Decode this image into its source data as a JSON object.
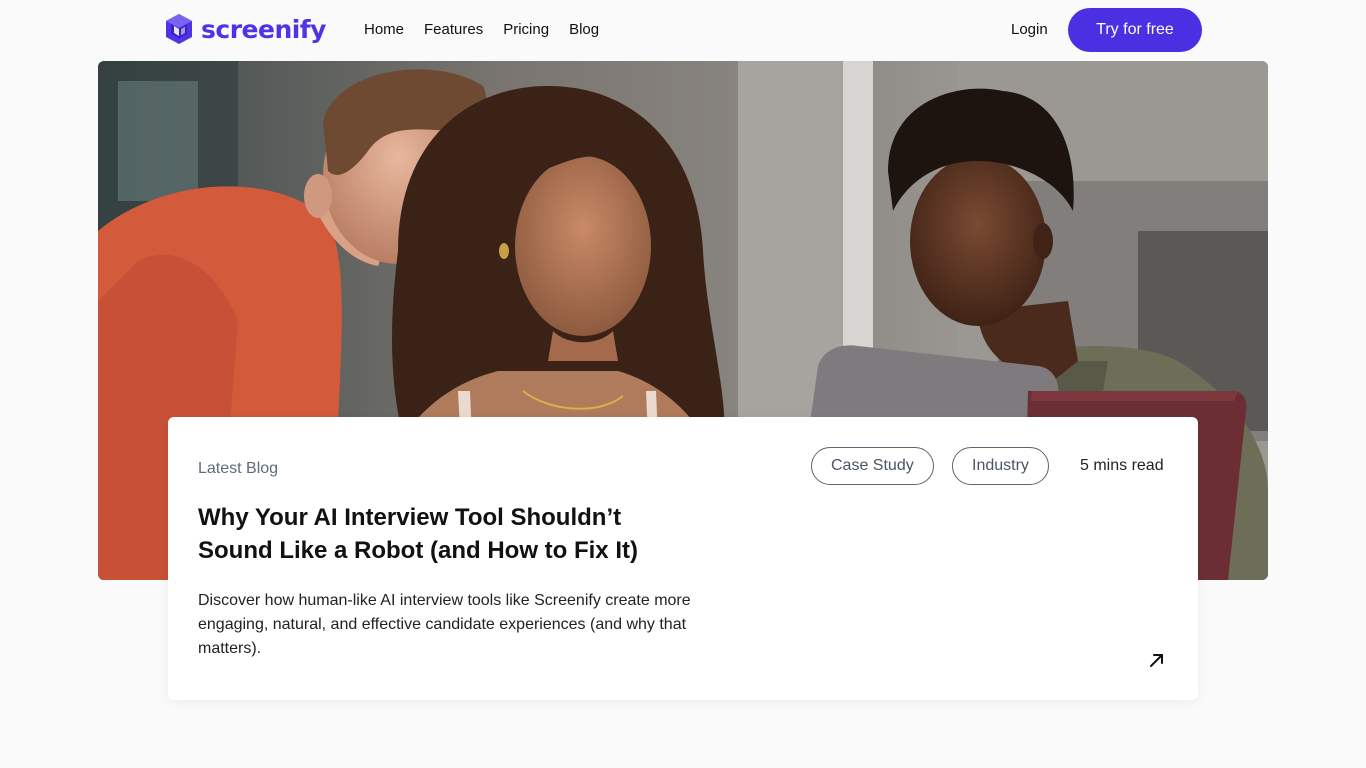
{
  "brand": {
    "name": "screenify",
    "color": "#4f34e6"
  },
  "nav": {
    "links": [
      "Home",
      "Features",
      "Pricing",
      "Blog"
    ],
    "login": "Login",
    "cta": "Try for free",
    "cta_color": "#4a2fe3"
  },
  "hero": {
    "image": "photo of three young people looking at a laptop"
  },
  "card": {
    "eyebrow": "Latest Blog",
    "title": "Why Your AI Interview Tool Shouldn’t Sound Like a Robot (and How to Fix It)",
    "excerpt": "Discover how human-like AI interview tools like Screenify create more engaging, natural, and effective candidate experiences (and why that matters).",
    "tags": [
      "Case Study",
      "Industry"
    ],
    "read_time": "5 mins read",
    "arrow_icon": "arrow-up-right-icon"
  }
}
